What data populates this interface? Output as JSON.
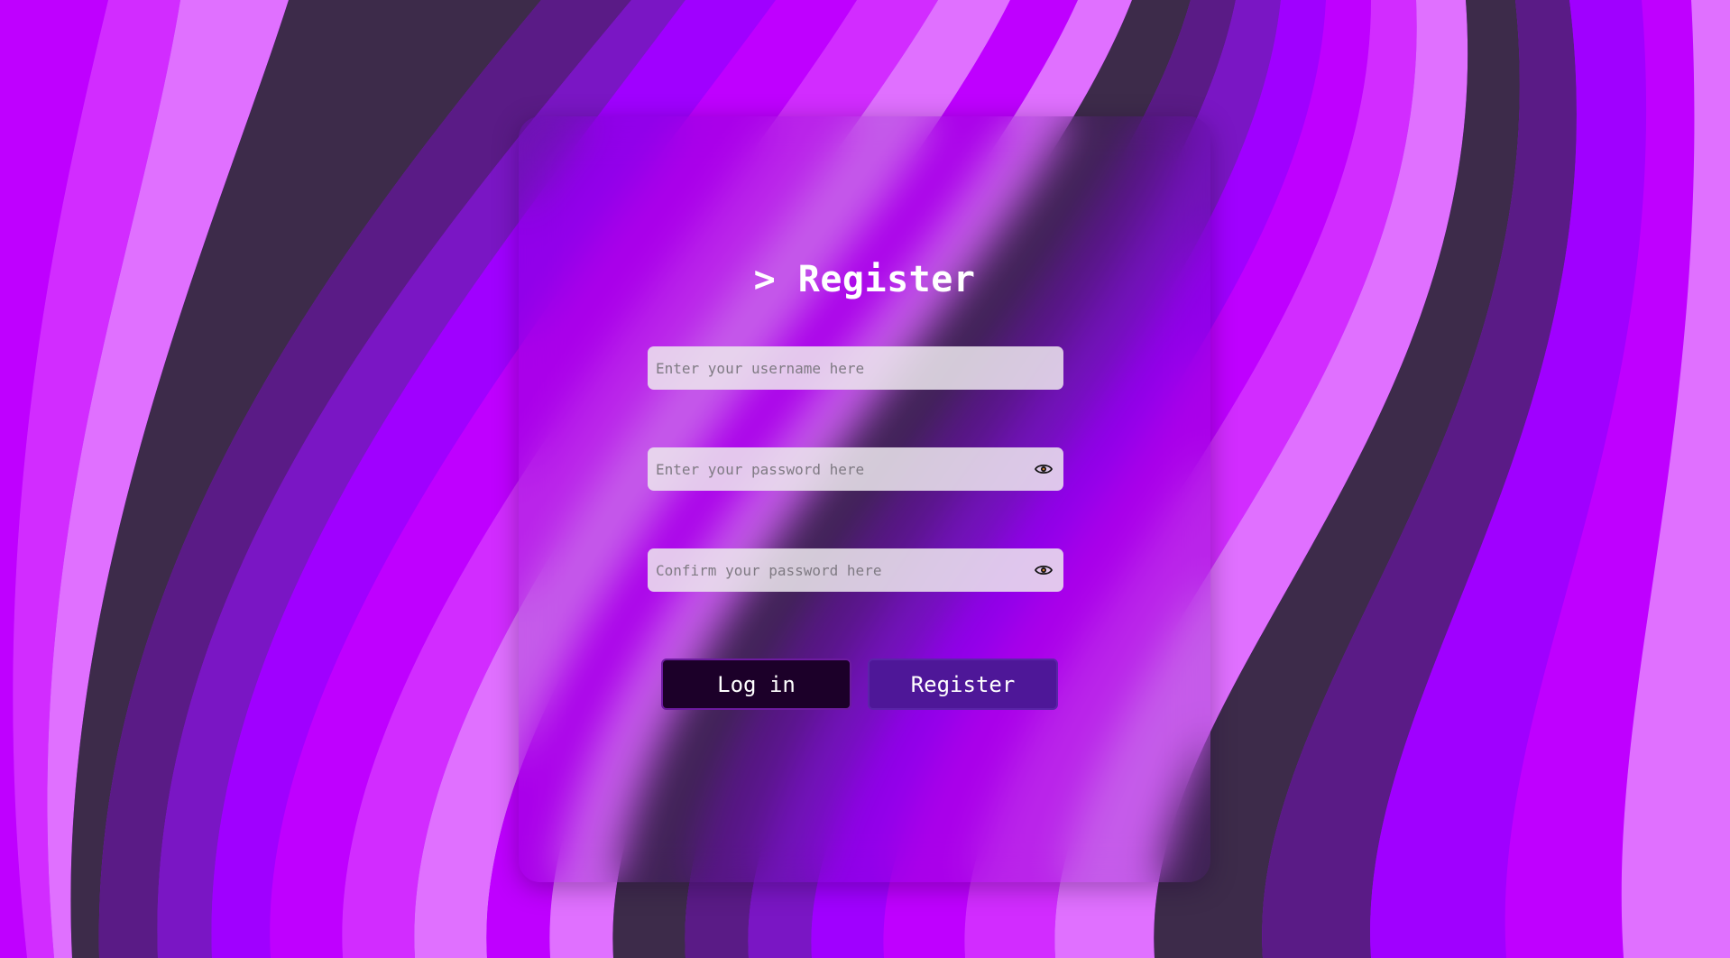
{
  "form": {
    "title": "> Register",
    "username_placeholder": "Enter your username here",
    "password_placeholder": "Enter your password here",
    "confirm_placeholder": "Confirm your password here",
    "login_label": "Log in",
    "register_label": "Register"
  },
  "icons": {
    "password_toggle": "eye-icon",
    "confirm_toggle": "eye-icon"
  },
  "colors": {
    "background_stripes": [
      "#a000ff",
      "#bf00ff",
      "#d22cff",
      "#e070ff",
      "#3d2b4a",
      "#5a1b86",
      "#7a16c4"
    ],
    "login_button": "#1c0029",
    "register_button": "#4e1798",
    "input_background": "#ece6ee",
    "title_text": "#ffffff"
  }
}
